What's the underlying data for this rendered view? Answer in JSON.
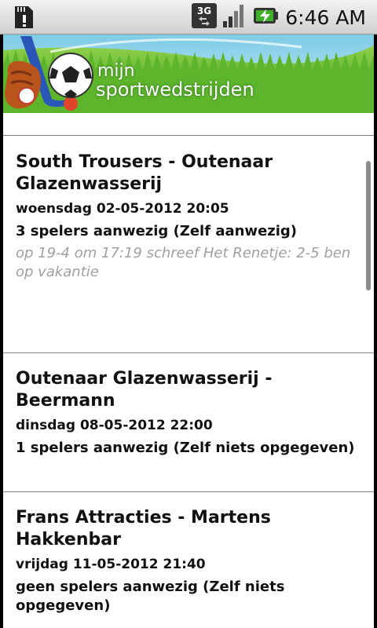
{
  "status_bar": {
    "network": "3G",
    "time": "6:46 AM"
  },
  "header": {
    "brand_line1": "mijn",
    "brand_line2": "sportwedstrijden"
  },
  "matches": [
    {
      "title": "South Trousers - Outenaar Glazenwasserij",
      "date": "woensdag 02-05-2012 20:05",
      "players": "3 spelers aanwezig (Zelf aanwezig)",
      "comment": "op 19-4 om 17:19 schreef Het Renetje: 2-5 ben op vakantie"
    },
    {
      "title": "Outenaar Glazenwasserij - Beermann",
      "date": "dinsdag 08-05-2012 22:00",
      "players": "1 spelers aanwezig (Zelf niets opgegeven)",
      "comment": ""
    },
    {
      "title": "Frans Attracties - Martens Hakkenbar",
      "date": "vrijdag 11-05-2012 21:40",
      "players": "geen spelers aanwezig (Zelf niets opgegeven)",
      "comment": ""
    }
  ]
}
